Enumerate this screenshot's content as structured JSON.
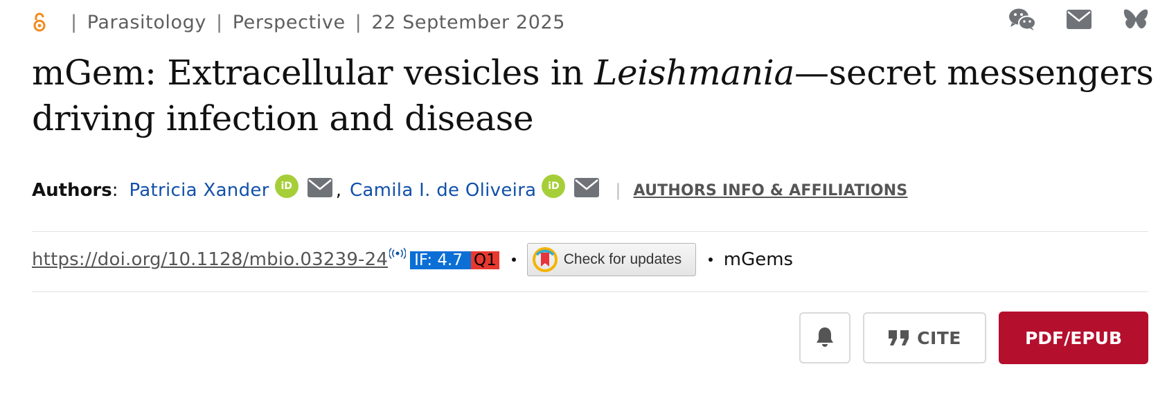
{
  "meta": {
    "section": "Parasitology",
    "article_type": "Perspective",
    "date": "22 September 2025",
    "separator": "|",
    "open_access_icon": "open-access-lock-icon"
  },
  "share": {
    "icons": [
      "wechat-icon",
      "email-icon",
      "bluesky-icon"
    ]
  },
  "title": {
    "part1": "mGem: Extracellular vesicles in ",
    "italic": "Leishmania",
    "part2": "—secret messengers driving infection and disease"
  },
  "authors": {
    "label": "Authors",
    "colon": ":",
    "list": [
      {
        "name": "Patricia Xander",
        "orcid": "iD"
      },
      {
        "name": "Camila I. de Oliveira",
        "orcid": "iD"
      }
    ],
    "comma": ",",
    "separator": "|",
    "affiliations_link": "AUTHORS INFO & AFFILIATIONS"
  },
  "article_info": {
    "doi": "https://doi.org/10.1128/mbio.03239-24",
    "impact_factor": "IF: 4.7",
    "quartile": "Q1",
    "check_updates": "Check for updates",
    "collection": "mGems"
  },
  "actions": {
    "alert_icon": "bell-icon",
    "cite_label": "CITE",
    "pdf_label": "PDF/EPUB"
  },
  "colors": {
    "accent_red": "#b50f2e",
    "link_blue": "#1150a8",
    "orcid_green": "#a6ce39",
    "if_blue": "#0b6fd6",
    "q1_red": "#e7392f",
    "open_access_orange": "#f28a1a"
  }
}
